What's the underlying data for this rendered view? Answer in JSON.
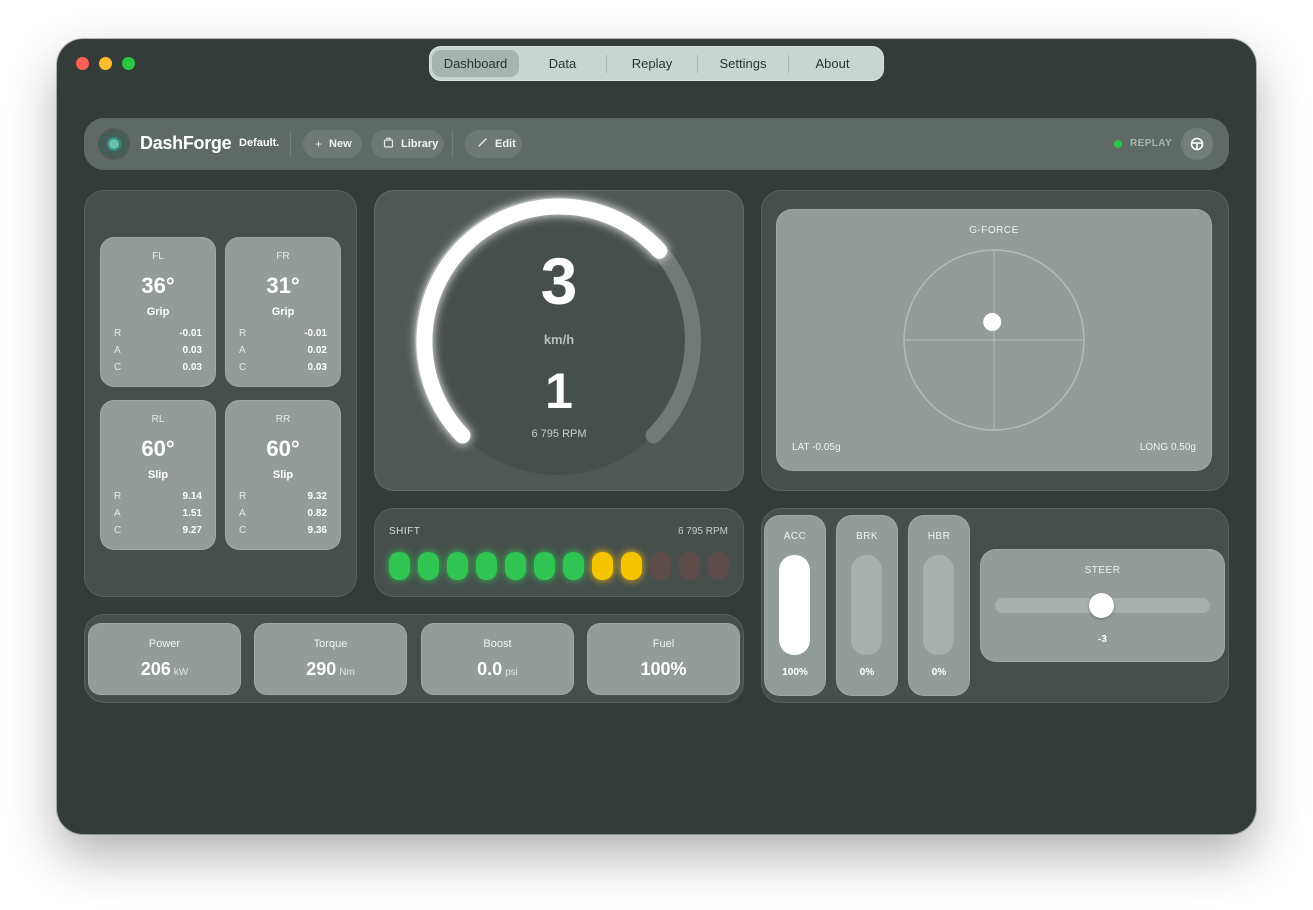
{
  "nav": {
    "tabs": [
      {
        "label": "Dashboard"
      },
      {
        "label": "Data"
      },
      {
        "label": "Replay"
      },
      {
        "label": "Settings"
      },
      {
        "label": "About"
      }
    ],
    "active_tab": "Dashboard"
  },
  "toolbar": {
    "app_name": "DashForge",
    "profile": "Default.",
    "new_label": "New",
    "library_label": "Library",
    "edit_label": "Edit",
    "replay_label": "REPLAY",
    "replay_status_color": "#28c840"
  },
  "tires": [
    {
      "code": "FL",
      "temp": "36°",
      "state": "Grip",
      "rows": [
        {
          "k": "R",
          "v": "-0.01"
        },
        {
          "k": "A",
          "v": "0.03"
        },
        {
          "k": "C",
          "v": "0.03"
        }
      ]
    },
    {
      "code": "FR",
      "temp": "31°",
      "state": "Grip",
      "rows": [
        {
          "k": "R",
          "v": "-0.01"
        },
        {
          "k": "A",
          "v": "0.02"
        },
        {
          "k": "C",
          "v": "0.03"
        }
      ]
    },
    {
      "code": "RL",
      "temp": "60°",
      "state": "Slip",
      "rows": [
        {
          "k": "R",
          "v": "9.14"
        },
        {
          "k": "A",
          "v": "1.51"
        },
        {
          "k": "C",
          "v": "9.27"
        }
      ]
    },
    {
      "code": "RR",
      "temp": "60°",
      "state": "Slip",
      "rows": [
        {
          "k": "R",
          "v": "9.32"
        },
        {
          "k": "A",
          "v": "0.82"
        },
        {
          "k": "C",
          "v": "9.36"
        }
      ]
    }
  ],
  "gauge": {
    "speed": "3",
    "speed_unit": "km/h",
    "gear": "1",
    "rpm_text": "6 795 RPM",
    "arc_fraction": 0.68
  },
  "gforce": {
    "title": "G-FORCE",
    "lat_label": "LAT -0.05g",
    "long_label": "LONG 0.50g",
    "lat": -0.05,
    "long": 0.5,
    "max_g": 2.5
  },
  "shift": {
    "label": "SHIFT",
    "rpm_text": "6 795 RPM",
    "leds_total": 12,
    "leds_lit": 9,
    "led_colors": [
      "green",
      "green",
      "green",
      "green",
      "green",
      "green",
      "green",
      "yellow",
      "yellow",
      "red",
      "red",
      "red"
    ],
    "colors": {
      "green": "#30c452",
      "yellow": "#f5c400",
      "red": "#5e4c4a"
    }
  },
  "stats": [
    {
      "label": "Power",
      "value": "206",
      "unit": "kW"
    },
    {
      "label": "Torque",
      "value": "290",
      "unit": "Nm"
    },
    {
      "label": "Boost",
      "value": "0.0",
      "unit": "psi"
    },
    {
      "label": "Fuel",
      "value": "100%",
      "unit": ""
    }
  ],
  "pedals": [
    {
      "label": "ACC",
      "value_text": "100%",
      "fraction": 1.0
    },
    {
      "label": "BRK",
      "value_text": "0%",
      "fraction": 0.0
    },
    {
      "label": "HBR",
      "value_text": "0%",
      "fraction": 0.0
    }
  ],
  "steer": {
    "label": "STEER",
    "value_text": "-3",
    "value": -3,
    "range": 450
  }
}
